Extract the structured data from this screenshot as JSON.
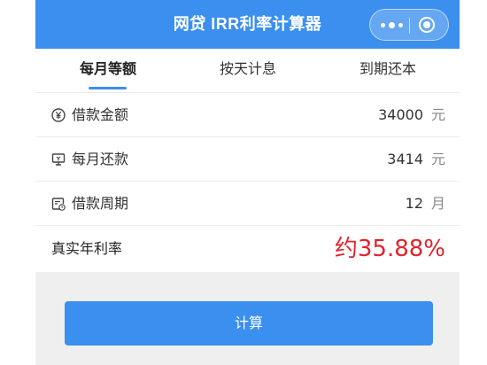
{
  "header": {
    "title": "网贷 IRR利率计算器",
    "more_icon": "more-dots-icon",
    "close_icon": "close-target-icon",
    "color": "#3b8fee"
  },
  "tabs": [
    {
      "label": "每月等额",
      "active": true
    },
    {
      "label": "按天计息",
      "active": false
    },
    {
      "label": "到期还本",
      "active": false
    }
  ],
  "form": {
    "loan_amount": {
      "label": "借款金额",
      "value": "34000",
      "unit": "元",
      "icon": "yen-circle-icon"
    },
    "monthly_payment": {
      "label": "每月还款",
      "value": "3414",
      "unit": "元",
      "icon": "monitor-icon"
    },
    "loan_period": {
      "label": "借款周期",
      "value": "12",
      "unit": "月",
      "icon": "calendar-clock-icon"
    }
  },
  "result": {
    "label": "真实年利率",
    "value": "约35.88%",
    "color": "#e0242b"
  },
  "actions": {
    "calculate_label": "计算"
  }
}
